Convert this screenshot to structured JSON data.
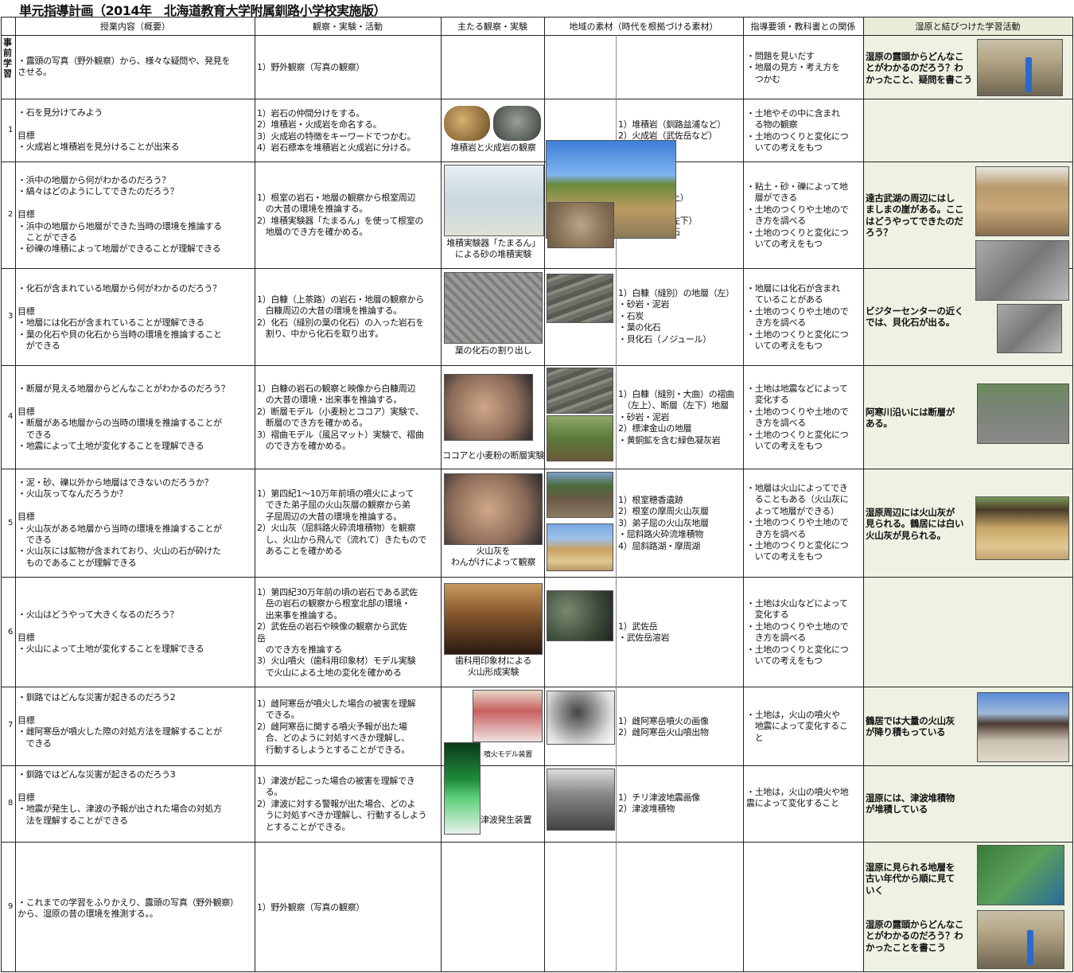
{
  "title": "単元指導計画（2014年　北海道教育大学附属釧路小学校実施版）",
  "headers": [
    "授業内容（概要）",
    "観察・実験・活動",
    "主たる観察・実験",
    "地域の素材（時代を根拠づける素材）",
    "指導要領・教科書との関係",
    "湿原と結びつけた学習活動"
  ],
  "rows": [
    {
      "num": "事\n前\n学\n習",
      "content": "・露頭の写真（野外観察）から、様々な疑問や、発見を\nさせる。",
      "activity": "1）野外観察（写真の観察）",
      "material": "",
      "guide": "・問題を見いだす\n・地層の見方・考え方を\n　つかむ",
      "wet": "湿原の露頭からどんなこ\nとがわかるのだろう？わ\nかったこと、疑問を書こう"
    },
    {
      "num": "1",
      "content": "・石を見分けてみよう\n\n目標\n・火成岩と堆積岩を見分けることが出来る",
      "activity": "1）岩石の仲間分けをする。\n2）堆積岩・火成岩を命名する。\n3）火成岩の特徴をキーワードでつかむ。\n4）岩石標本を堆積岩と火成岩に分ける。",
      "caption": "堆積岩と火成岩の観察",
      "material": "1）堆積岩（釧路益浦など）\n2）火成岩（武佐岳など）",
      "guide": "・土地やその中に含まれ\n　る物の観察\n・土地のつくりと変化につ\n　いての考えをもつ",
      "wet": ""
    },
    {
      "num": "2",
      "content": "・浜中の地層から何がわかるのだろう？\n・縞々はどのようにしてできたのだろう？\n\n目標\n・浜中の地層から地層ができた当時の環境を推論する\n　ことができる\n・砂礫の堆積によって地層ができることが理解できる",
      "activity": "1）根室の岩石・地層の観察から根室周辺\n　の大昔の環境を推論する。\n2）堆積実験器「たまるん」を使って根室の\n　地層のでき方を確かめる。",
      "caption": "堆積実験器「たまるん」\nによる砂の堆積実験",
      "material": "層（左上）\n\n地層（左下）\nトの化石",
      "guide": "・粘土・砂・礫によって地\n　層ができる\n・土地のつくりや土地ので\n　き方を調べる\n・土地のつくりと変化につ\n　いての考えをもつ",
      "wet": "達古武湖の周辺にはし\nましまの崖がある。ここ\nはどうやってできたのだ\nろう？"
    },
    {
      "num": "3",
      "content": "・化石が含まれている地層から何がわかるのだろう？\n\n目標\n・地層には化石が含まれていることが理解できる\n・葉の化石や貝の化石から当時の環境を推論すること\n　ができる",
      "activity": "1）白糠（上茶路）の岩石・地層の観察から\n　白糠周辺の大昔の環境を推論する。\n2）化石（縫別の葉の化石）の入った岩石を\n　割り、中から化石を取り出す。",
      "caption": "葉の化石の割り出し",
      "material": "1）白糠（縫別）の地層（左）\n・砂岩・泥岩\n・石炭\n・葉の化石\n・貝化石（ノジュール）",
      "guide": "・地層には化石が含まれ\n　ていることがある\n・土地のつくりや土地ので\n　き方を調べる\n・土地のつくりと変化につ\n　いての考えをもつ",
      "wet": "ビジターセンターの近く\nでは、貝化石が出る。"
    },
    {
      "num": "4",
      "content": "・断層が見える地層からどんなことがわかるのだろう？\n\n目標\n・断層がある地層からの当時の環境を推論することが\n　できる\n・地震によって土地が変化することを理解できる",
      "activity": "1）白糠の岩石の観察と映像から白糠周辺\n　の大昔の環境・出来事を推論する。\n2）断層モデル（小麦粉とココア）実験で、\n　断層のでき方を確かめる。\n3）褶曲モデル（風呂マット）実験で、褶曲\n　のでき方を確かめる。",
      "caption": "ココアと小麦粉の断層実験",
      "material": "1）白糠（縫別・大曲）の褶曲\n　（左上）、断層（左下）地層\n・砂岩・泥岩\n2）標津金山の地層\n・黄銅鉱を含む緑色凝灰岩",
      "guide": "・土地は地震などによって\n　変化する\n・土地のつくりや土地ので\n　き方を調べる\n・土地のつくりと変化につ\n　いての考えをもつ",
      "wet": "阿寒川沿いには断層が\nある。"
    },
    {
      "num": "5",
      "content": "・泥・砂、礫以外から地層はできないのだろうか？\n・火山灰ってなんだろうか？\n\n目標\n・火山灰がある地層から当時の環境を推論することが\n　できる\n・火山灰には鉱物が含まれており、火山の石が砕けた\n　ものであることが理解できる",
      "activity": "1）第四紀1〜10万年前頃の噴火によって\n　できた弟子屈の火山灰層の観察から弟\n　子屈周辺の大昔の環境を推論する。\n2）火山灰（屈斜路火砕流堆積物）を観察\n　し、火山から飛んで（流れて）きたもので\n　あることを確かめる",
      "caption": "火山灰を\nわんがけによって観察",
      "material": "1）根室穂香遺跡\n2）根室の摩周火山灰層\n3）弟子屈の火山灰地層\n・屈斜路火砕流堆積物\n4）屈斜路湖・摩周湖",
      "guide": "・地層は火山によってでき\n　ることもある（火山灰に\n　よって地層ができる）\n・土地のつくりや土地ので\n　き方を調べる\n・土地のつくりと変化につ\n　いての考えをもつ",
      "wet": "湿原周辺には火山灰が\n見られる。鶴居には白い\n火山灰が見られる。"
    },
    {
      "num": "6",
      "content": "・火山はどうやって大きくなるのだろう？\n\n目標\n・火山によって土地が変化することを理解できる",
      "activity": "1）第四紀30万年前の頃の岩石である武佐\n　岳の岩石の観察から根室北部の環境・\n　出来事を推論する。\n2）武佐岳の岩石や映像の観察から武佐\n岳\n　のでき方を推論する\n3）火山噴火（歯科用印象材）モデル実験\n　で火山による土地の変化を確かめる",
      "caption": "歯科用印象材による\n火山形成実験",
      "material": "1）武佐岳\n・武佐岳溶岩",
      "guide": "・土地は火山などによって\n　変化する\n・土地のつくりや土地ので\n　き方を調べる\n・土地のつくりと変化につ\n　いての考えをもつ",
      "wet": ""
    },
    {
      "num": "7",
      "content": "・釧路ではどんな災害が起きるのだろう2\n\n目標\n・雌阿寒岳が噴火した際の対処方法を理解することが\n　できる",
      "activity": "1）雌阿寒岳が噴火した場合の被害を理解\n　できる。\n2）雌阿寒岳に関する噴火予報が出た場\n　合、どのように対処すべきか理解し、\n　行動するしようとすることができる。",
      "caption": "噴火モデル装置",
      "material": "1）雌阿寒岳噴火の画像\n2）雌阿寒岳火山噴出物",
      "guide": "・土地は，火山の噴火や\n　地震によって変化するこ\n　と",
      "wet": "鶴居では大量の火山灰\nが降り積もっている"
    },
    {
      "num": "8",
      "content": "・釧路ではどんな災害が起きるのだろう3\n\n目標\n・地震が発生し、津波の予報が出された場合の対処方\n　法を理解することができる",
      "activity": "1）津波が起こった場合の被害を理解でき\n　る。\n2）津波に対する警報が出た場合、どのよ\n　うに対処すべきか理解し、行動するしよう\n　とすることができる。",
      "caption": "津波発生装置",
      "material": "1）チリ津波地震画像\n2）津波堆積物",
      "guide": "・土地は，火山の噴火や地\n震によって変化すること",
      "wet": "湿原には、津波堆積物\nが堆積している"
    },
    {
      "num": "9",
      "content": "・これまでの学習をふりかえり、露頭の写真（野外観察）\nから、湿原の昔の環境を推測する。。",
      "activity": "1）野外観察（写真の観察）",
      "material": "",
      "guide": "",
      "wet": "湿原に見られる地層を\n古い年代から順に見て\nいく",
      "wet2": "湿原の露頭からどんなこ\nとがわかるのだろう？わ\nかったことを書こう"
    }
  ]
}
